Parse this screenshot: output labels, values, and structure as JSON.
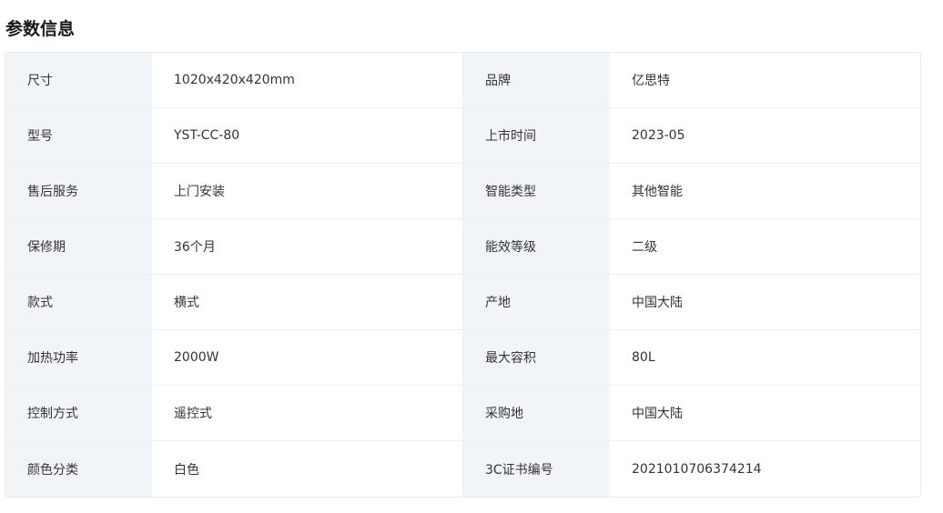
{
  "section": {
    "title": "参数信息"
  },
  "params": [
    {
      "label_left": "尺寸",
      "value_left": "1020x420x420mm",
      "label_right": "品牌",
      "value_right": "亿思特"
    },
    {
      "label_left": "型号",
      "value_left": "YST-CC-80",
      "label_right": "上市时间",
      "value_right": "2023-05"
    },
    {
      "label_left": "售后服务",
      "value_left": "上门安装",
      "label_right": "智能类型",
      "value_right": "其他智能"
    },
    {
      "label_left": "保修期",
      "value_left": "36个月",
      "label_right": "能效等级",
      "value_right": "二级"
    },
    {
      "label_left": "款式",
      "value_left": "横式",
      "label_right": "产地",
      "value_right": "中国大陆"
    },
    {
      "label_left": "加热功率",
      "value_left": "2000W",
      "label_right": "最大容积",
      "value_right": "80L"
    },
    {
      "label_left": "控制方式",
      "value_left": "遥控式",
      "label_right": "采购地",
      "value_right": "中国大陆"
    },
    {
      "label_left": "颜色分类",
      "value_left": "白色",
      "label_right": "3C证书编号",
      "value_right": "2021010706374214"
    }
  ]
}
